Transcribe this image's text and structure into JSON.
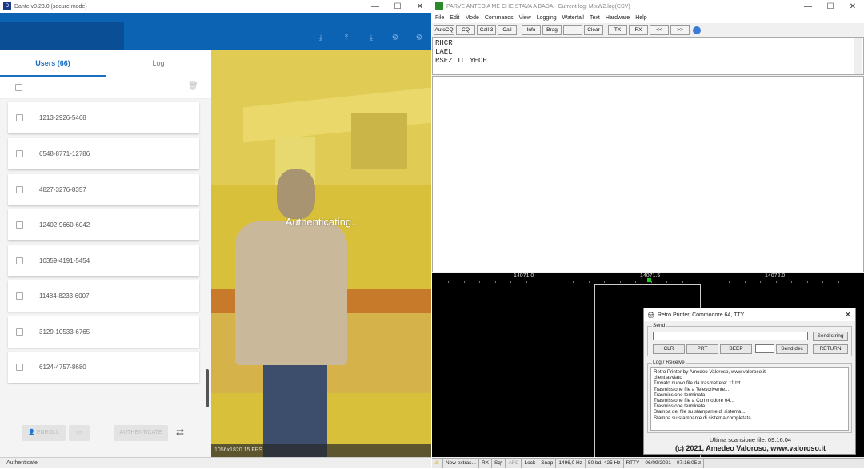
{
  "left_app": {
    "title": "Dante v0.23.0 (secure mode)",
    "window_controls": {
      "minimize": "—",
      "maximize": "☐",
      "close": "✕"
    },
    "banner_icons": [
      "download-icon",
      "upload-icon",
      "download-icon",
      "settings-icon",
      "gear-icon"
    ],
    "tabs": [
      {
        "label": "Users (66)",
        "active": true
      },
      {
        "label": "Log",
        "active": false
      }
    ],
    "users": [
      "1213-2926-5468",
      "6548-8771-12786",
      "4827-3276-8357",
      "12402-9660-6042",
      "10359-4191-5454",
      "11484-8233-6007",
      "3129-10533-6765",
      "6124-4757-8680"
    ],
    "footer_buttons": {
      "enroll": "ENROLL",
      "authenticate": "AUTHENTICATE"
    },
    "status_text": "Authenticate",
    "video": {
      "overlay_text": "Authenticating..",
      "info": "1056x1820   15 FPS"
    }
  },
  "right_app": {
    "title": "PARVE ANTEO A ME CHE STAVA A BADA - Current log: MixW2.log(CSV)",
    "window_controls": {
      "minimize": "—",
      "maximize": "☐",
      "close": "✕"
    },
    "menu": [
      "File",
      "Edit",
      "Mode",
      "Commands",
      "View",
      "Logging",
      "Waterfall",
      "Text",
      "Hardware",
      "Help"
    ],
    "toolbar": [
      "AutoCQ",
      "CQ",
      "Call 3",
      "Call",
      "Info",
      "Brag",
      "",
      "Clear",
      "TX",
      "RX",
      "<<",
      ">>"
    ],
    "rx_lines": [
      "RHCR",
      "LAEL",
      "RSEZ TL YEOH"
    ],
    "waterfall": {
      "freqs": [
        "14071.0",
        "14071.5",
        "14072.0"
      ]
    },
    "status_bar": [
      "New extras...",
      "RX",
      "Sq*",
      "AFC",
      "Lock",
      "Snap",
      "1496,0 Hz",
      "50 bd, 425 Hz",
      "RTTY",
      "06/09/2021",
      "07:16:05 z"
    ]
  },
  "dialog": {
    "title": "Retro Printer, Commodore 64, TTY",
    "close": "✕",
    "send_group": "Send",
    "send_string_btn": "Send string",
    "buttons": [
      "CLR",
      "PRT",
      "BEEP"
    ],
    "send_dec_btn": "Send dec",
    "return_btn": "RETURN",
    "log_group": "Log / Receive",
    "log_lines": [
      "Retro Printer by Amedeo Valoroso, www.valoroso.it",
      "client avviato",
      "Trovato nuovo file da trasmettere: 11.txt",
      "Trasmissione file a Telescrivente...",
      "Trasmissione terminata",
      "Trasmissione file a Commodore 64...",
      "Trasmissione terminata",
      "Stampa del file su stampante di sistema...",
      "Stampa su stampante di sistema completata"
    ],
    "last_scan": "Ultima scansione file: 09:16:04",
    "copyright": "(c) 2021, Amedeo Valoroso, www.valoroso.it"
  }
}
